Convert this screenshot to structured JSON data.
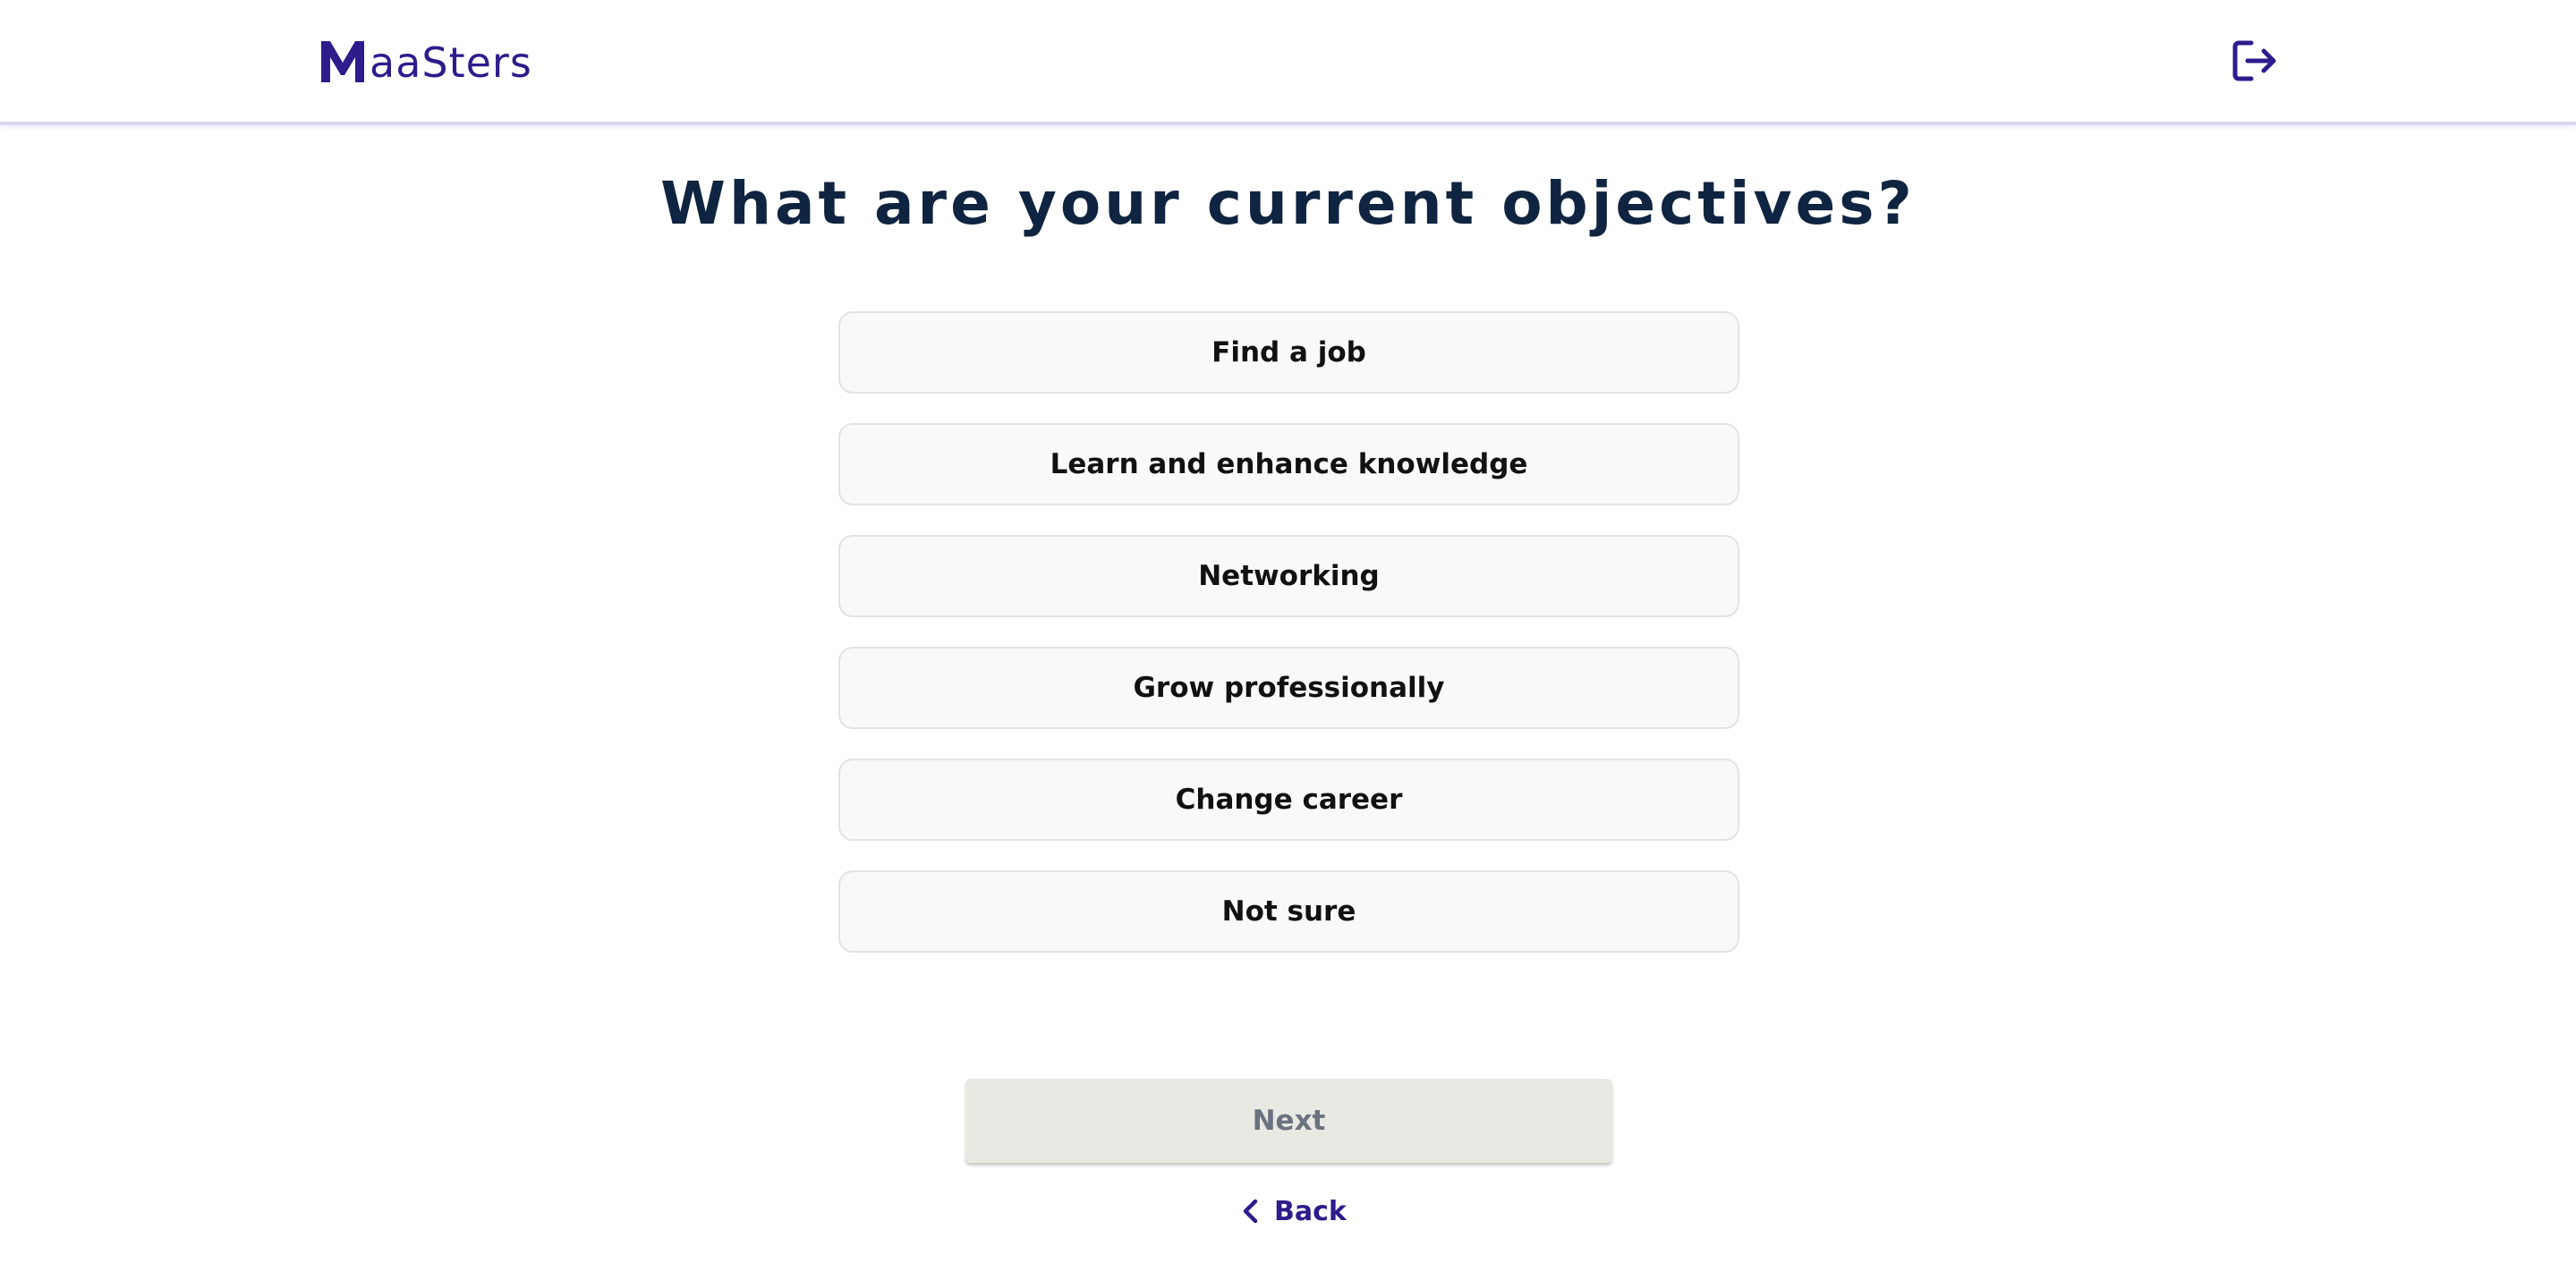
{
  "header": {
    "brand": "MaaSters",
    "logo_rest": "aaSters",
    "brand_color": "#2e1b8c",
    "logout_icon": "logout-icon"
  },
  "main": {
    "title": "What are your current objectives?",
    "options": [
      {
        "label": "Find a job"
      },
      {
        "label": "Learn and enhance knowledge"
      },
      {
        "label": "Networking"
      },
      {
        "label": "Grow professionally"
      },
      {
        "label": "Change career"
      },
      {
        "label": "Not sure"
      }
    ]
  },
  "footer": {
    "next_label": "Next",
    "next_disabled": true,
    "back_label": "Back",
    "back_icon": "chevron-left-icon"
  },
  "colors": {
    "accent": "#2e1b8c",
    "title": "#0f2440",
    "option_bg": "#f9f9f9",
    "option_border": "#e3e3e3",
    "next_bg": "#e9e9e4",
    "next_text": "#6b7280"
  }
}
